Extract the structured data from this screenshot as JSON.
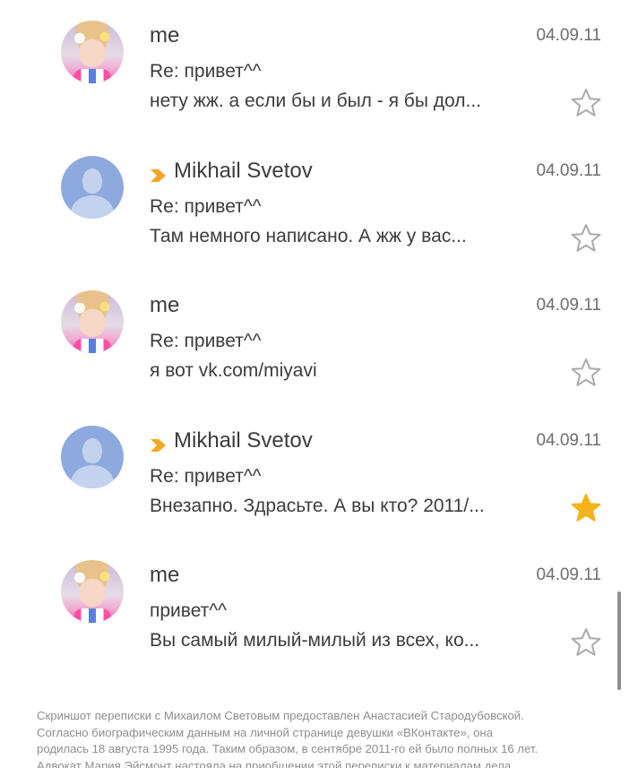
{
  "messages": [
    {
      "sender": "me",
      "avatar": "user-photo",
      "forwarded": false,
      "date": "04.09.11",
      "subject": "Re: привет^^",
      "preview": "нету жж. а если бы и был - я бы дол...",
      "starred": false
    },
    {
      "sender": "Mikhail Svetov",
      "avatar": "default-person",
      "forwarded": true,
      "date": "04.09.11",
      "subject": "Re: привет^^",
      "preview": "Там немного написано. А жж у вас...",
      "starred": false
    },
    {
      "sender": "me",
      "avatar": "user-photo",
      "forwarded": false,
      "date": "04.09.11",
      "subject": "Re: привет^^",
      "preview": "я вот vk.com/miyavi",
      "starred": false
    },
    {
      "sender": "Mikhail Svetov",
      "avatar": "default-person",
      "forwarded": true,
      "date": "04.09.11",
      "subject": "Re: привет^^",
      "preview": "Внезапно. Здрасьте. А вы кто? 2011/...",
      "starred": true
    },
    {
      "sender": "me",
      "avatar": "user-photo",
      "forwarded": false,
      "date": "04.09.11",
      "subject": "привет^^",
      "preview": "Вы самый милый-милый из всех, ко...",
      "starred": false
    }
  ],
  "icons": {
    "forward": "forward-chevron-icon",
    "star_empty": "star-outline-icon",
    "star_filled": "star-filled-icon"
  },
  "colors": {
    "forward_accent": "#f5a623",
    "star_filled": "#f5b21b",
    "star_outline": "#a9a9ae",
    "text_primary": "#3c3c3e",
    "text_secondary": "#6d6d72",
    "caption": "#8e8e93",
    "default_avatar": "#8ea9dd"
  },
  "caption": {
    "lines": [
      "Скриншот переписки с Михаилом Световым предоставлен Анастасией Стародубовской.",
      "Согласно биографическим данным на личной странице девушки «ВКонтакте», она",
      "родилась 18 августа 1995 года. Таким образом, в сентябре 2011-го ей было полных 16 лет.",
      "Адвокат Мария Эйсмонт настояла на приобщении этой переписки к материалам дела"
    ]
  }
}
